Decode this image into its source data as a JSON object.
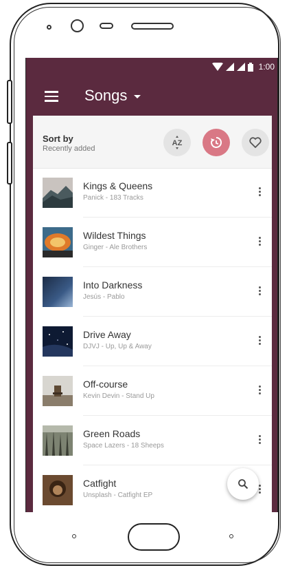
{
  "status": {
    "time": "1:00"
  },
  "appbar": {
    "title": "Songs"
  },
  "sort": {
    "label": "Sort by",
    "value": "Recently added",
    "az_label": "AZ"
  },
  "songs": [
    {
      "title": "Kings & Queens",
      "subtitle": "Panick - 183 Tracks"
    },
    {
      "title": "Wildest Things",
      "subtitle": "Ginger - Ale Brothers"
    },
    {
      "title": "Into Darkness",
      "subtitle": "Jesús - Pablo"
    },
    {
      "title": "Drive Away",
      "subtitle": "DJVJ - Up, Up & Away"
    },
    {
      "title": "Off-course",
      "subtitle": "Kevin Devin - Stand Up"
    },
    {
      "title": "Green Roads",
      "subtitle": "Space Lazers - 18 Sheeps"
    },
    {
      "title": "Catfight",
      "subtitle": "Unsplash - Catfight EP"
    }
  ],
  "colors": {
    "primary": "#5b2a3f",
    "accent": "#d97885"
  }
}
